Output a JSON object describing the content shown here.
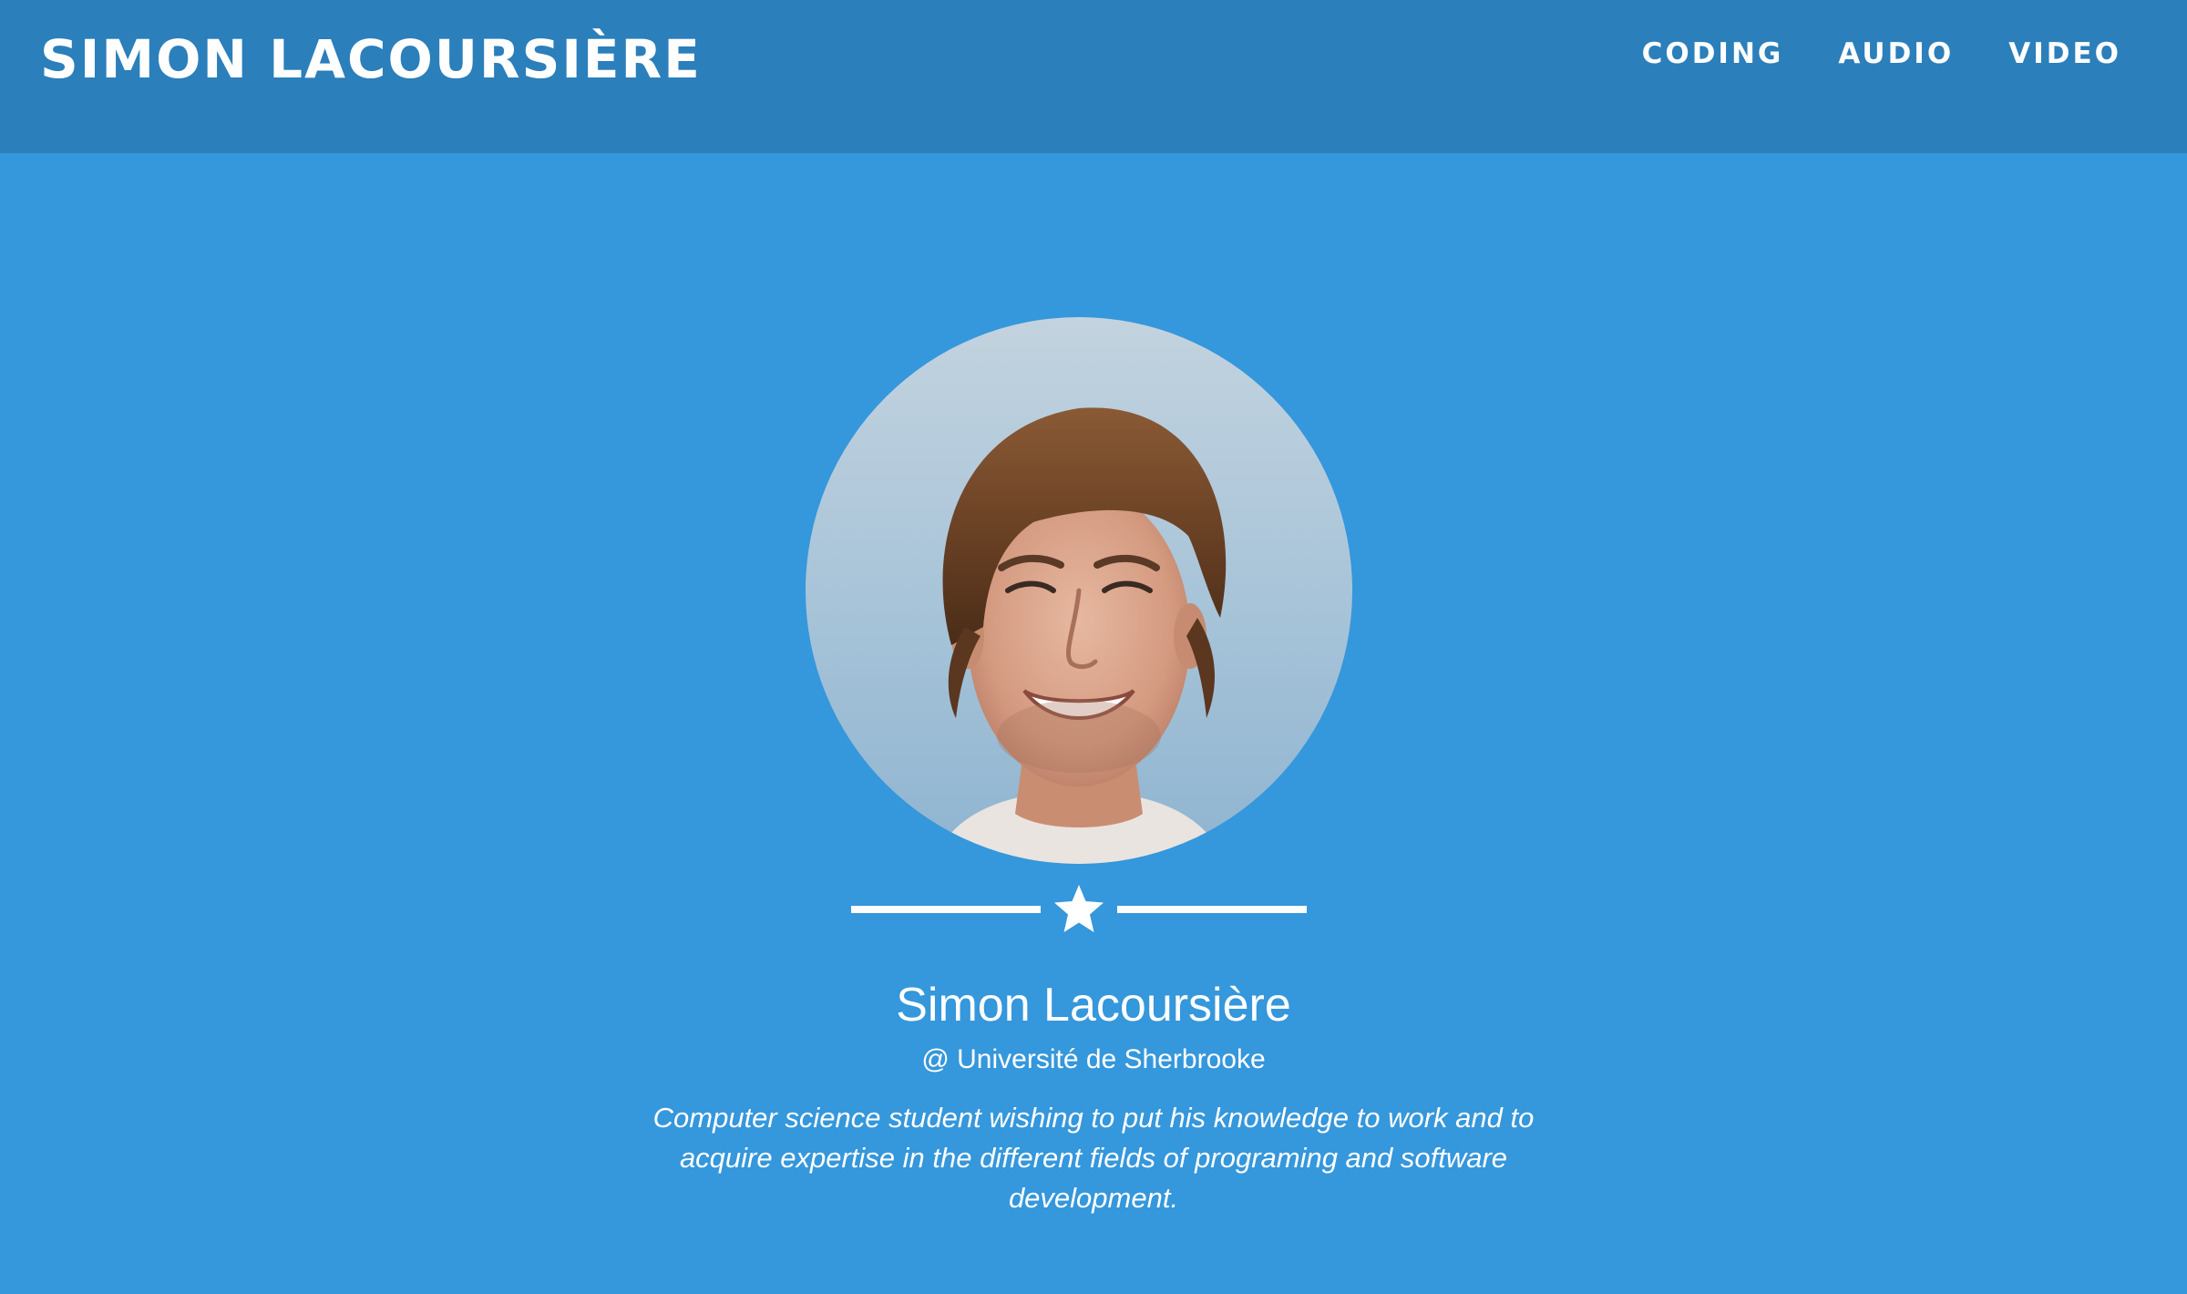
{
  "navbar": {
    "brand": "SIMON LACOURSIÈRE",
    "links": [
      {
        "label": "CODING"
      },
      {
        "label": "AUDIO"
      },
      {
        "label": "VIDEO"
      }
    ]
  },
  "profile": {
    "name": "Simon Lacoursière",
    "affiliation": "@ Université de Sherbrooke",
    "bio": "Computer science student wishing to put his knowledge to work and to acquire expertise in the different fields of programing and software development.",
    "divider_icon": "star-icon"
  },
  "colors": {
    "background": "#3597dc",
    "navbar": "#2b7fbb",
    "text": "#ffffff"
  }
}
